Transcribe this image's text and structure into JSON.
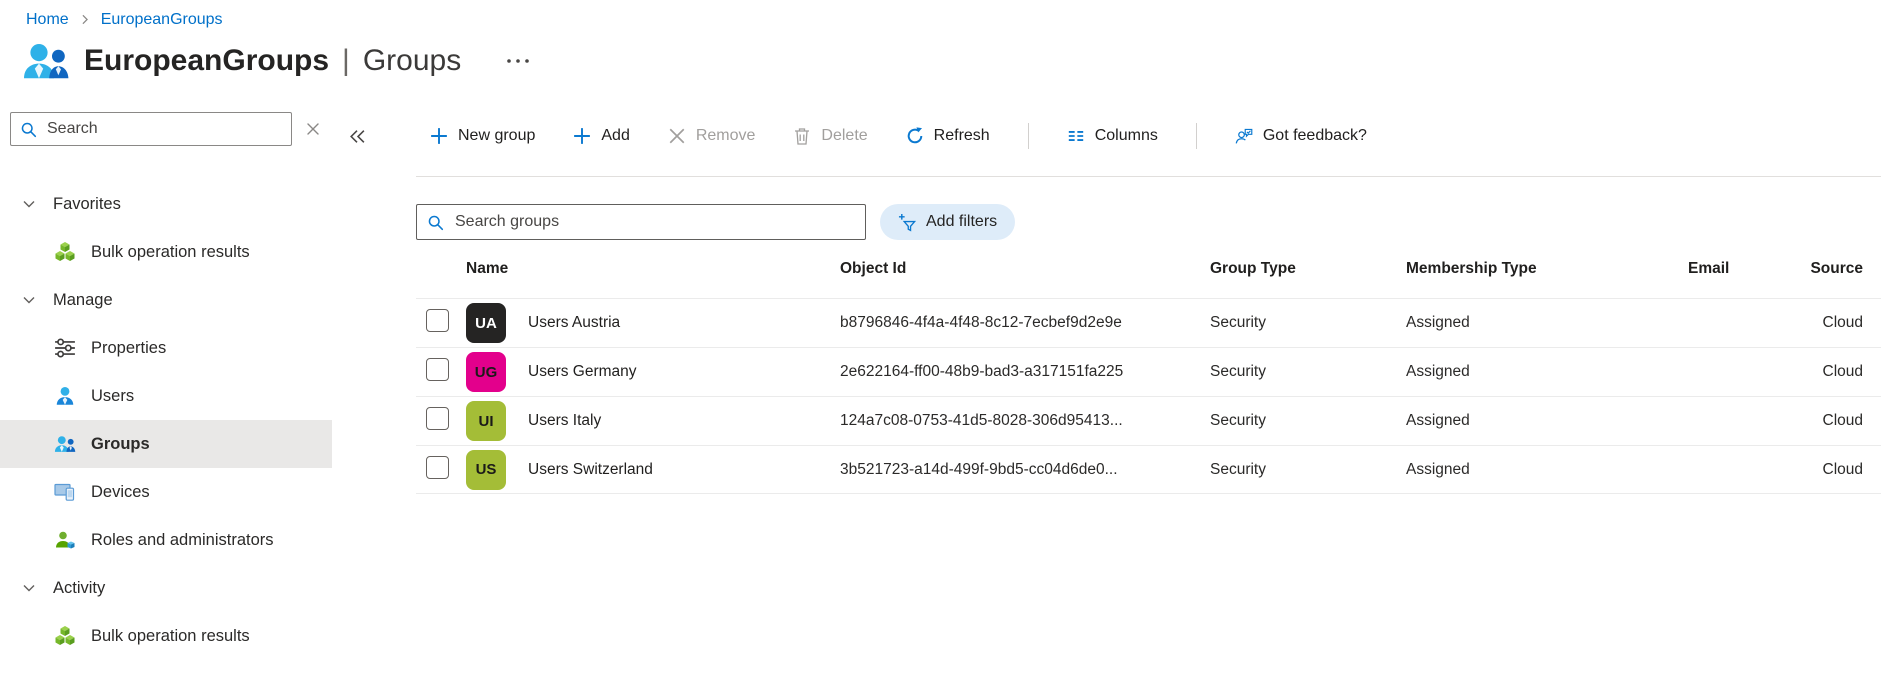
{
  "colors": {
    "accent": "#0078d4",
    "link": "#0070c9",
    "selected_item_bg": "#e9e8e7",
    "add_filters_bg": "#deecf9",
    "disabled_text": "#a19f9d"
  },
  "breadcrumb": {
    "items": [
      "Home",
      "EuropeanGroups"
    ],
    "separator_icon": "chevron-right-icon"
  },
  "page": {
    "title": "EuropeanGroups",
    "divider": "|",
    "section": "Groups",
    "icon": "groups-icon",
    "more_icon": "more-icon"
  },
  "sidebar": {
    "search": {
      "placeholder": "Search",
      "icon": "search-icon",
      "clear_icon": "clear-icon"
    },
    "collapse_icon": "collapse-icon",
    "items": [
      {
        "kind": "section",
        "label": "Favorites",
        "icon": "chevron-down-icon"
      },
      {
        "kind": "link",
        "label": "Bulk operation results",
        "icon": "cubes-icon"
      },
      {
        "kind": "section",
        "label": "Manage",
        "icon": "chevron-down-icon"
      },
      {
        "kind": "link",
        "label": "Properties",
        "icon": "sliders-icon"
      },
      {
        "kind": "link",
        "label": "Users",
        "icon": "user-icon"
      },
      {
        "kind": "link",
        "label": "Groups",
        "icon": "groups-icon",
        "selected": true
      },
      {
        "kind": "link",
        "label": "Devices",
        "icon": "devices-icon"
      },
      {
        "kind": "link",
        "label": "Roles and administrators",
        "icon": "roles-icon"
      },
      {
        "kind": "section",
        "label": "Activity",
        "icon": "chevron-down-icon"
      },
      {
        "kind": "link",
        "label": "Bulk operation results",
        "icon": "cubes-icon"
      }
    ]
  },
  "toolbar": {
    "buttons": [
      {
        "label": "New group",
        "icon": "plus-icon",
        "disabled": false
      },
      {
        "label": "Add",
        "icon": "plus-icon",
        "disabled": false
      },
      {
        "label": "Remove",
        "icon": "x-icon",
        "disabled": true
      },
      {
        "label": "Delete",
        "icon": "trash-icon",
        "disabled": true
      },
      {
        "label": "Refresh",
        "icon": "refresh-icon",
        "disabled": false
      },
      {
        "label": "Columns",
        "icon": "columns-icon",
        "disabled": false,
        "divider_before": true
      },
      {
        "label": "Got feedback?",
        "icon": "feedback-icon",
        "disabled": false,
        "divider_before": true
      }
    ]
  },
  "filters": {
    "search_placeholder": "Search groups",
    "search_icon": "search-icon",
    "add_filters": {
      "label": "Add filters",
      "icon": "filter-add-icon"
    }
  },
  "table": {
    "columns": [
      "Name",
      "Object Id",
      "Group Type",
      "Membership Type",
      "Email",
      "Source"
    ],
    "rows": [
      {
        "initials": "UA",
        "avatar_bg": "#252423",
        "avatar_fg": "#ffffff",
        "name": "Users Austria",
        "object_id": "b8796846-4f4a-4f48-8c12-7ecbef9d2e9e",
        "group_type": "Security",
        "membership_type": "Assigned",
        "email": "",
        "source": "Cloud"
      },
      {
        "initials": "UG",
        "avatar_bg": "#e3008c",
        "avatar_fg": "#1b1a19",
        "name": "Users Germany",
        "object_id": "2e622164-ff00-48b9-bad3-a317151fa225",
        "group_type": "Security",
        "membership_type": "Assigned",
        "email": "",
        "source": "Cloud"
      },
      {
        "initials": "UI",
        "avatar_bg": "#a4bd37",
        "avatar_fg": "#1b1a19",
        "name": "Users Italy",
        "object_id": "124a7c08-0753-41d5-8028-306d95413...",
        "group_type": "Security",
        "membership_type": "Assigned",
        "email": "",
        "source": "Cloud"
      },
      {
        "initials": "US",
        "avatar_bg": "#a4bd37",
        "avatar_fg": "#1b1a19",
        "name": "Users Switzerland",
        "object_id": "3b521723-a14d-499f-9bd5-cc04d6de0...",
        "group_type": "Security",
        "membership_type": "Assigned",
        "email": "",
        "source": "Cloud"
      }
    ]
  }
}
